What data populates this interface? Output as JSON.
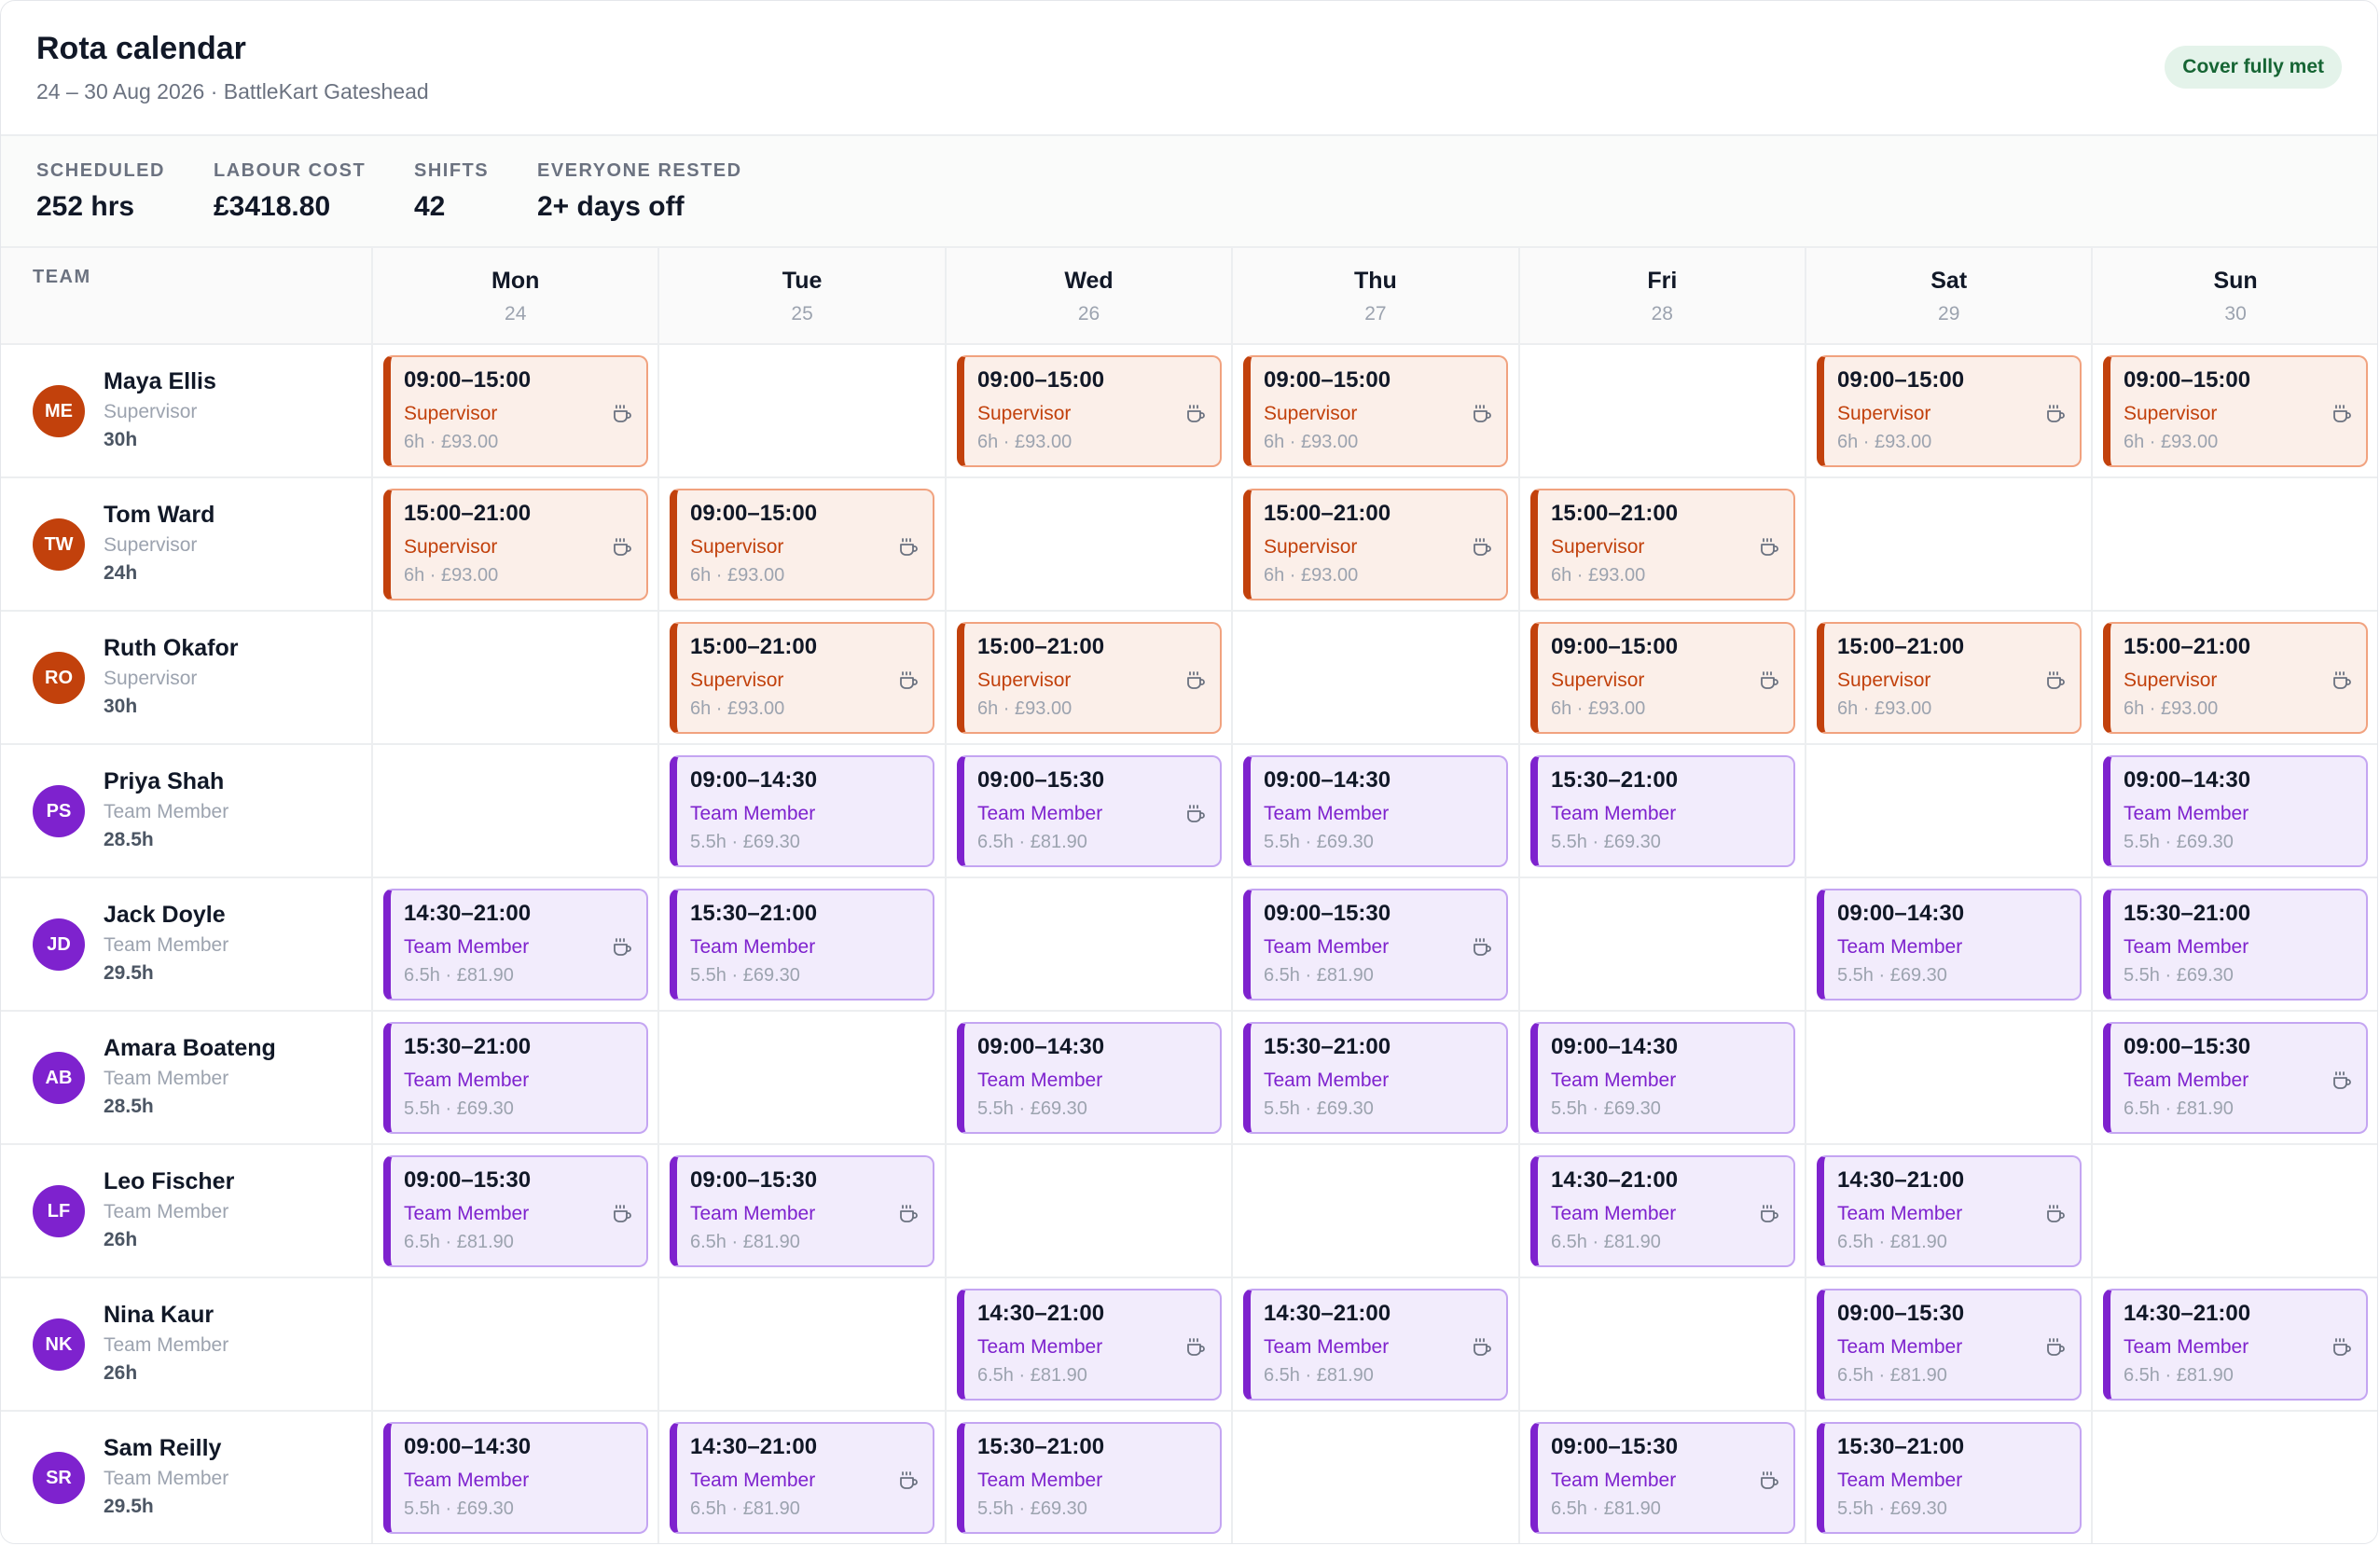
{
  "header": {
    "title": "Rota calendar",
    "subtitle": "24 – 30 Aug 2026 · BattleKart Gateshead",
    "badge": "Cover fully met"
  },
  "stats": [
    {
      "label": "SCHEDULED",
      "value": "252 hrs"
    },
    {
      "label": "LABOUR COST",
      "value": "£3418.80"
    },
    {
      "label": "SHIFTS",
      "value": "42"
    },
    {
      "label": "EVERYONE RESTED",
      "value": "2+ days off"
    }
  ],
  "team_header": "TEAM",
  "days": [
    {
      "name": "Mon",
      "date": "24"
    },
    {
      "name": "Tue",
      "date": "25"
    },
    {
      "name": "Wed",
      "date": "26"
    },
    {
      "name": "Thu",
      "date": "27"
    },
    {
      "name": "Fri",
      "date": "28"
    },
    {
      "name": "Sat",
      "date": "29"
    },
    {
      "name": "Sun",
      "date": "30"
    }
  ],
  "colors": {
    "supervisor_accent": "#c2410c",
    "team_member_accent": "#7e22ce",
    "cover_badge": "#166534"
  },
  "break_icon": "coffee-cup-icon",
  "employees": [
    {
      "initials": "ME",
      "name": "Maya Ellis",
      "role": "Supervisor",
      "hours": "30h",
      "type": "sup",
      "shifts": [
        {
          "time": "09:00–15:00",
          "role": "Supervisor",
          "meta": "6h · £93.00",
          "break": true
        },
        null,
        {
          "time": "09:00–15:00",
          "role": "Supervisor",
          "meta": "6h · £93.00",
          "break": true
        },
        {
          "time": "09:00–15:00",
          "role": "Supervisor",
          "meta": "6h · £93.00",
          "break": true
        },
        null,
        {
          "time": "09:00–15:00",
          "role": "Supervisor",
          "meta": "6h · £93.00",
          "break": true
        },
        {
          "time": "09:00–15:00",
          "role": "Supervisor",
          "meta": "6h · £93.00",
          "break": true
        }
      ]
    },
    {
      "initials": "TW",
      "name": "Tom Ward",
      "role": "Supervisor",
      "hours": "24h",
      "type": "sup",
      "shifts": [
        {
          "time": "15:00–21:00",
          "role": "Supervisor",
          "meta": "6h · £93.00",
          "break": true
        },
        {
          "time": "09:00–15:00",
          "role": "Supervisor",
          "meta": "6h · £93.00",
          "break": true
        },
        null,
        {
          "time": "15:00–21:00",
          "role": "Supervisor",
          "meta": "6h · £93.00",
          "break": true
        },
        {
          "time": "15:00–21:00",
          "role": "Supervisor",
          "meta": "6h · £93.00",
          "break": true
        },
        null,
        null
      ]
    },
    {
      "initials": "RO",
      "name": "Ruth Okafor",
      "role": "Supervisor",
      "hours": "30h",
      "type": "sup",
      "shifts": [
        null,
        {
          "time": "15:00–21:00",
          "role": "Supervisor",
          "meta": "6h · £93.00",
          "break": true
        },
        {
          "time": "15:00–21:00",
          "role": "Supervisor",
          "meta": "6h · £93.00",
          "break": true
        },
        null,
        {
          "time": "09:00–15:00",
          "role": "Supervisor",
          "meta": "6h · £93.00",
          "break": true
        },
        {
          "time": "15:00–21:00",
          "role": "Supervisor",
          "meta": "6h · £93.00",
          "break": true
        },
        {
          "time": "15:00–21:00",
          "role": "Supervisor",
          "meta": "6h · £93.00",
          "break": true
        }
      ]
    },
    {
      "initials": "PS",
      "name": "Priya Shah",
      "role": "Team Member",
      "hours": "28.5h",
      "type": "tm",
      "shifts": [
        null,
        {
          "time": "09:00–14:30",
          "role": "Team Member",
          "meta": "5.5h · £69.30",
          "break": false
        },
        {
          "time": "09:00–15:30",
          "role": "Team Member",
          "meta": "6.5h · £81.90",
          "break": true
        },
        {
          "time": "09:00–14:30",
          "role": "Team Member",
          "meta": "5.5h · £69.30",
          "break": false
        },
        {
          "time": "15:30–21:00",
          "role": "Team Member",
          "meta": "5.5h · £69.30",
          "break": false
        },
        null,
        {
          "time": "09:00–14:30",
          "role": "Team Member",
          "meta": "5.5h · £69.30",
          "break": false
        }
      ]
    },
    {
      "initials": "JD",
      "name": "Jack Doyle",
      "role": "Team Member",
      "hours": "29.5h",
      "type": "tm",
      "shifts": [
        {
          "time": "14:30–21:00",
          "role": "Team Member",
          "meta": "6.5h · £81.90",
          "break": true
        },
        {
          "time": "15:30–21:00",
          "role": "Team Member",
          "meta": "5.5h · £69.30",
          "break": false
        },
        null,
        {
          "time": "09:00–15:30",
          "role": "Team Member",
          "meta": "6.5h · £81.90",
          "break": true
        },
        null,
        {
          "time": "09:00–14:30",
          "role": "Team Member",
          "meta": "5.5h · £69.30",
          "break": false
        },
        {
          "time": "15:30–21:00",
          "role": "Team Member",
          "meta": "5.5h · £69.30",
          "break": false
        }
      ]
    },
    {
      "initials": "AB",
      "name": "Amara Boateng",
      "role": "Team Member",
      "hours": "28.5h",
      "type": "tm",
      "shifts": [
        {
          "time": "15:30–21:00",
          "role": "Team Member",
          "meta": "5.5h · £69.30",
          "break": false
        },
        null,
        {
          "time": "09:00–14:30",
          "role": "Team Member",
          "meta": "5.5h · £69.30",
          "break": false
        },
        {
          "time": "15:30–21:00",
          "role": "Team Member",
          "meta": "5.5h · £69.30",
          "break": false
        },
        {
          "time": "09:00–14:30",
          "role": "Team Member",
          "meta": "5.5h · £69.30",
          "break": false
        },
        null,
        {
          "time": "09:00–15:30",
          "role": "Team Member",
          "meta": "6.5h · £81.90",
          "break": true
        }
      ]
    },
    {
      "initials": "LF",
      "name": "Leo Fischer",
      "role": "Team Member",
      "hours": "26h",
      "type": "tm",
      "shifts": [
        {
          "time": "09:00–15:30",
          "role": "Team Member",
          "meta": "6.5h · £81.90",
          "break": true
        },
        {
          "time": "09:00–15:30",
          "role": "Team Member",
          "meta": "6.5h · £81.90",
          "break": true
        },
        null,
        null,
        {
          "time": "14:30–21:00",
          "role": "Team Member",
          "meta": "6.5h · £81.90",
          "break": true
        },
        {
          "time": "14:30–21:00",
          "role": "Team Member",
          "meta": "6.5h · £81.90",
          "break": true
        },
        null
      ]
    },
    {
      "initials": "NK",
      "name": "Nina Kaur",
      "role": "Team Member",
      "hours": "26h",
      "type": "tm",
      "shifts": [
        null,
        null,
        {
          "time": "14:30–21:00",
          "role": "Team Member",
          "meta": "6.5h · £81.90",
          "break": true
        },
        {
          "time": "14:30–21:00",
          "role": "Team Member",
          "meta": "6.5h · £81.90",
          "break": true
        },
        null,
        {
          "time": "09:00–15:30",
          "role": "Team Member",
          "meta": "6.5h · £81.90",
          "break": true
        },
        {
          "time": "14:30–21:00",
          "role": "Team Member",
          "meta": "6.5h · £81.90",
          "break": true
        }
      ]
    },
    {
      "initials": "SR",
      "name": "Sam Reilly",
      "role": "Team Member",
      "hours": "29.5h",
      "type": "tm",
      "shifts": [
        {
          "time": "09:00–14:30",
          "role": "Team Member",
          "meta": "5.5h · £69.30",
          "break": false
        },
        {
          "time": "14:30–21:00",
          "role": "Team Member",
          "meta": "6.5h · £81.90",
          "break": true
        },
        {
          "time": "15:30–21:00",
          "role": "Team Member",
          "meta": "5.5h · £69.30",
          "break": false
        },
        null,
        {
          "time": "09:00–15:30",
          "role": "Team Member",
          "meta": "6.5h · £81.90",
          "break": true
        },
        {
          "time": "15:30–21:00",
          "role": "Team Member",
          "meta": "5.5h · £69.30",
          "break": false
        },
        null
      ]
    }
  ]
}
